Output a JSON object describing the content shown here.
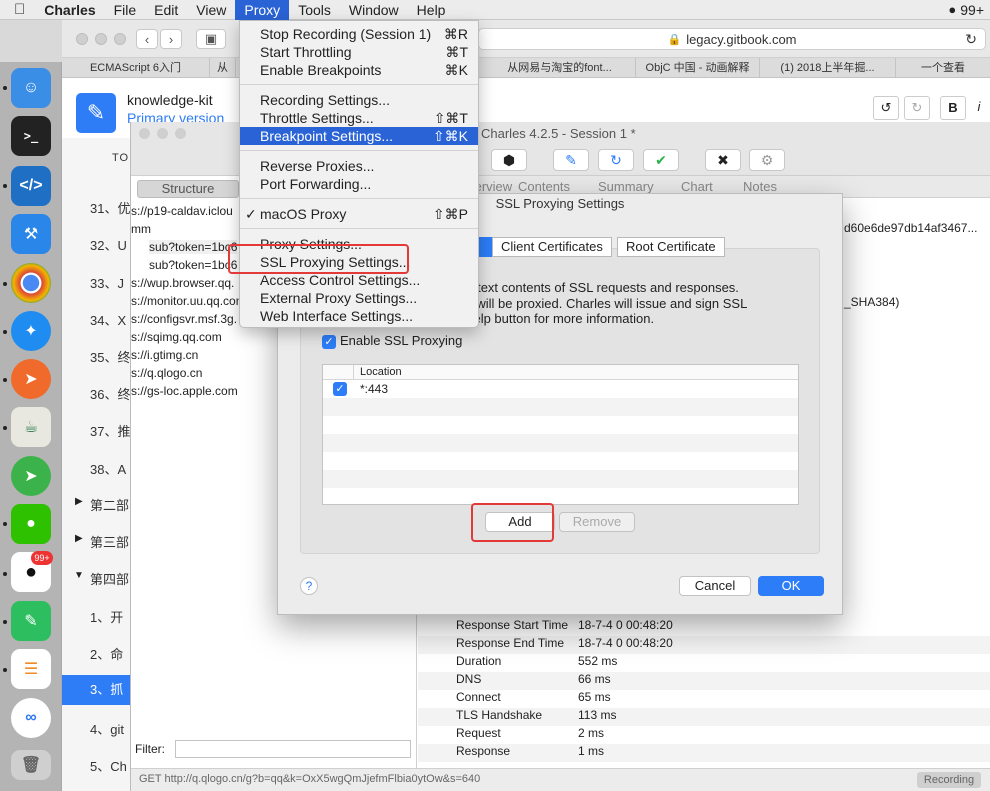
{
  "menubar": {
    "app_name": "Charles",
    "items": [
      "File",
      "Edit",
      "View",
      "Proxy",
      "Tools",
      "Window",
      "Help"
    ],
    "badge": "99+"
  },
  "browser": {
    "url": "legacy.gitbook.com",
    "tabs": [
      "ECMAScript 6入门",
      "从",
      "从网易与淘宝的font...",
      "ObjC 中国 - 动画解释",
      "(1) 2018上半年掘...",
      "一个查看"
    ],
    "book_title": "knowledge-kit",
    "book_subtitle": "Primary version",
    "toc_header": "TO",
    "toc": [
      "31、优",
      "32、U",
      "33、J",
      "34、X",
      "35、终",
      "36、终",
      "37、推",
      "38、A",
      "第二部",
      "第三部",
      "第四部",
      "1、开",
      "2、命",
      "3、抓",
      "4、git",
      "5、Ch"
    ]
  },
  "charles": {
    "title": "Charles 4.2.5 - Session 1 *",
    "view_tabs": [
      "Structure",
      "Se"
    ],
    "right_tabs": [
      "Overview",
      "Contents",
      "Summary",
      "Chart",
      "Notes"
    ],
    "hosts": [
      "s://p19-caldav.iclou",
      "mm",
      "sub?token=1bc6",
      "sub?token=1bc6",
      "s://wup.browser.qq.",
      "s://monitor.uu.qq.com",
      "s://configsvr.msf.3g.",
      "s://sqimg.qq.com",
      "s://i.gtimg.cn",
      "s://q.qlogo.cn",
      "s://gs-loc.apple.com"
    ],
    "right_snippets": [
      "d60e6de97db14af3467...",
      "_SHA384)"
    ],
    "timing": [
      {
        "k": "Response Start Time",
        "v": "18-7-4 0 00:48:20"
      },
      {
        "k": "Response End Time",
        "v": "18-7-4 0 00:48:20"
      },
      {
        "k": "Duration",
        "v": "552 ms"
      },
      {
        "k": "DNS",
        "v": "66 ms"
      },
      {
        "k": "Connect",
        "v": "65 ms"
      },
      {
        "k": "TLS Handshake",
        "v": "113 ms"
      },
      {
        "k": "Request",
        "v": "2 ms"
      },
      {
        "k": "Response",
        "v": "1 ms"
      }
    ],
    "filter_label": "Filter:",
    "status_text": "GET http://q.qlogo.cn/g?b=qq&k=OxX5wgQmJjefmFlbia0ytOw&s=640",
    "recording": "Recording"
  },
  "proxy_menu": {
    "items": [
      {
        "label": "Stop Recording (Session 1)",
        "shortcut": "⌘R"
      },
      {
        "label": "Start Throttling",
        "shortcut": "⌘T"
      },
      {
        "label": "Enable Breakpoints",
        "shortcut": "⌘K"
      },
      {
        "label": "Recording Settings...",
        "shortcut": ""
      },
      {
        "label": "Throttle Settings...",
        "shortcut": "⇧⌘T"
      },
      {
        "label": "Breakpoint Settings...",
        "shortcut": "⇧⌘K"
      },
      {
        "label": "Reverse Proxies...",
        "shortcut": ""
      },
      {
        "label": "Port Forwarding...",
        "shortcut": ""
      },
      {
        "label": "macOS Proxy",
        "shortcut": "⇧⌘P"
      },
      {
        "label": "Proxy Settings...",
        "shortcut": ""
      },
      {
        "label": "SSL Proxying Settings...",
        "shortcut": ""
      },
      {
        "label": "Access Control Settings...",
        "shortcut": ""
      },
      {
        "label": "External Proxy Settings...",
        "shortcut": ""
      },
      {
        "label": "Web Interface Settings...",
        "shortcut": ""
      }
    ]
  },
  "ssl_dialog": {
    "title": "SSL Proxying Settings",
    "tabs": [
      "Client Certificates",
      "Root Certificate"
    ],
    "description_lines": [
      "plain text contents of SSL requests and responses.",
      "elow will be proxied. Charles will issue and sign SSL",
      "he Help button for more information."
    ],
    "enable_label": "Enable SSL Proxying",
    "table_header": "Location",
    "locations": [
      "*:443"
    ],
    "add_label": "Add",
    "remove_label": "Remove",
    "help_label": "?",
    "cancel_label": "Cancel",
    "ok_label": "OK"
  }
}
